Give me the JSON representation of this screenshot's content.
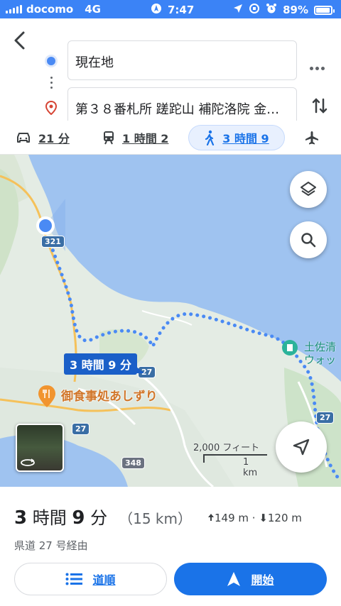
{
  "status_bar": {
    "carrier": "docomo",
    "network": "4G",
    "time": "7:47",
    "battery": "89%"
  },
  "search": {
    "origin": "現在地",
    "destination": "第３８番札所 蹉跎山 補陀洛院 金…"
  },
  "modes": {
    "car": "21 分",
    "transit": "1 時間 2",
    "walk": "3 時間 9",
    "selected": "walk"
  },
  "map": {
    "route_label": "3 時間 9 分",
    "poi_restaurant": "御食事処あしずり",
    "poi_right_line1": "土佐清",
    "poi_right_line2": "ウォッ",
    "road_321": "321",
    "road_27a": "27",
    "road_27b": "27",
    "road_27c": "27",
    "road_348": "348",
    "scale_ft": "2,000 フィート",
    "scale_km": "1 km"
  },
  "summary": {
    "duration_prefix": "3",
    "duration_unit1": "時間",
    "duration_minutes": "9",
    "duration_unit2": "分",
    "distance": "（15 km）",
    "elevation": "149 m · ⬇120 m",
    "via": "県道 27 号経由"
  },
  "actions": {
    "steps_label": "道順",
    "start_label": "開始"
  },
  "colors": {
    "accent": "#1a73e8",
    "status_bar": "#3b83f6",
    "sea": "#9fc3f0",
    "land": "#e4ece4"
  }
}
